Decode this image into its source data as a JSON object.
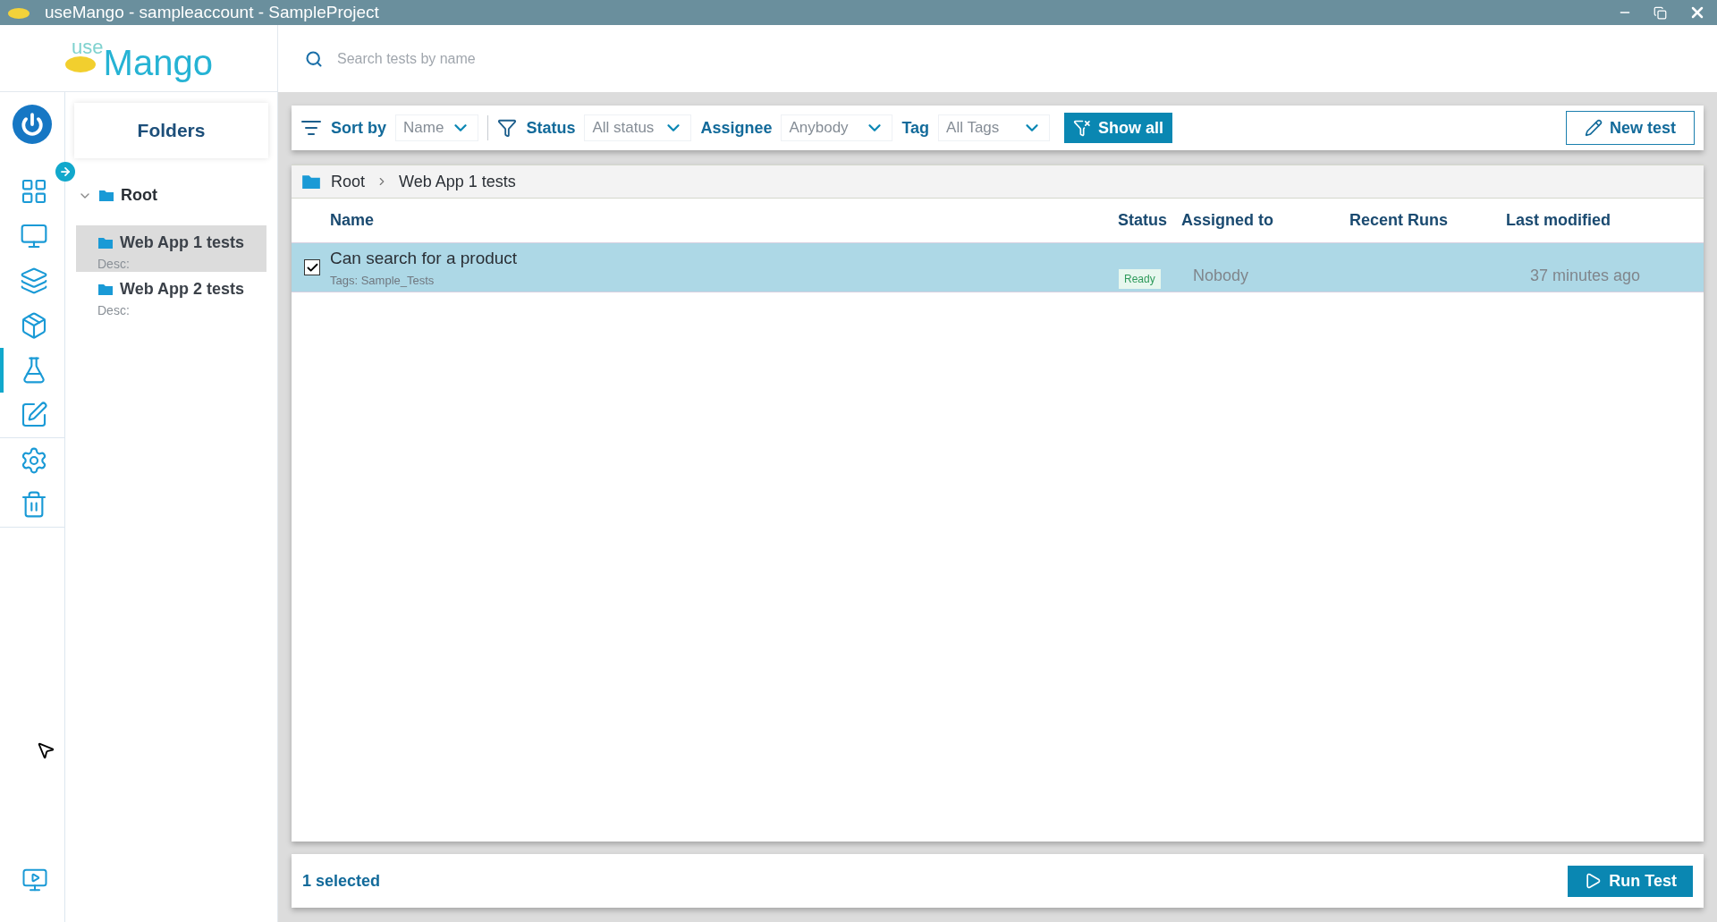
{
  "window": {
    "title": "useMango - sampleaccount - SampleProject"
  },
  "logo": {
    "prefix": "use",
    "name": "Mango"
  },
  "search": {
    "placeholder": "Search tests by name"
  },
  "nav": [
    {
      "kind": "dashboard",
      "selected": false
    },
    {
      "kind": "monitor",
      "selected": false
    },
    {
      "kind": "layers",
      "selected": false
    },
    {
      "kind": "package",
      "selected": false
    },
    {
      "kind": "flask",
      "selected": true
    },
    {
      "kind": "edit",
      "selected": false
    },
    {
      "kind": "settings",
      "selected": false
    },
    {
      "kind": "trash",
      "selected": false
    }
  ],
  "folders": {
    "title": "Folders",
    "root": {
      "label": "Root",
      "expanded": true,
      "children": [
        {
          "label": "Web App 1 tests",
          "desc": "Desc:",
          "selected": true
        },
        {
          "label": "Web App 2 tests",
          "desc": "Desc:",
          "selected": false
        }
      ]
    }
  },
  "toolbar": {
    "sort_label": "Sort by",
    "sort_value": "Name",
    "status_label": "Status",
    "status_value": "All status",
    "assignee_label": "Assignee",
    "assignee_value": "Anybody",
    "tag_label": "Tag",
    "tag_value": "All Tags",
    "show_all": "Show all",
    "new_test": "New test"
  },
  "breadcrumb": [
    "Root",
    "Web App 1 tests"
  ],
  "table": {
    "columns": [
      "Name",
      "Status",
      "Assigned to",
      "Recent Runs",
      "Last modified"
    ],
    "rows": [
      {
        "name": "Can search for a product",
        "tags_label": "Tags:",
        "tags": "Sample_Tests",
        "status": "Ready",
        "assigned": "Nobody",
        "modified": "37 minutes ago",
        "checked": true,
        "selected": true
      }
    ]
  },
  "footer": {
    "count": "1 selected",
    "run": "Run Test"
  }
}
